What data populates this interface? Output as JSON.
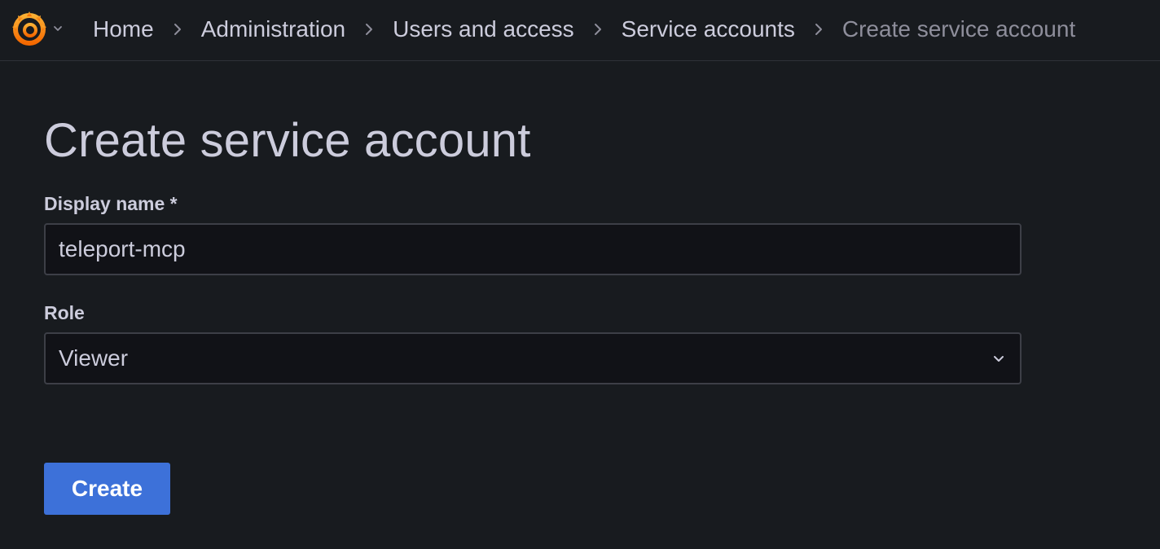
{
  "header": {
    "logo_icon": "grafana-logo-icon",
    "menu_toggle_icon": "chevron-down-icon",
    "breadcrumbs": [
      {
        "label": "Home"
      },
      {
        "label": "Administration"
      },
      {
        "label": "Users and access"
      },
      {
        "label": "Service accounts"
      },
      {
        "label": "Create service account"
      }
    ],
    "separator_icon": "chevron-right-icon"
  },
  "page": {
    "title": "Create service account"
  },
  "form": {
    "display_name": {
      "label": "Display name *",
      "value": "teleport-mcp"
    },
    "role": {
      "label": "Role",
      "value": "Viewer",
      "icon": "chevron-down-icon"
    },
    "submit_label": "Create"
  },
  "colors": {
    "background": "#181b1f",
    "input_background": "#111217",
    "input_border": "#3d3f47",
    "text": "#ccccdc",
    "text_muted": "#8e8e9b",
    "primary": "#3d71d9",
    "logo_orange": "#f46800",
    "logo_yellow": "#fbb033"
  }
}
